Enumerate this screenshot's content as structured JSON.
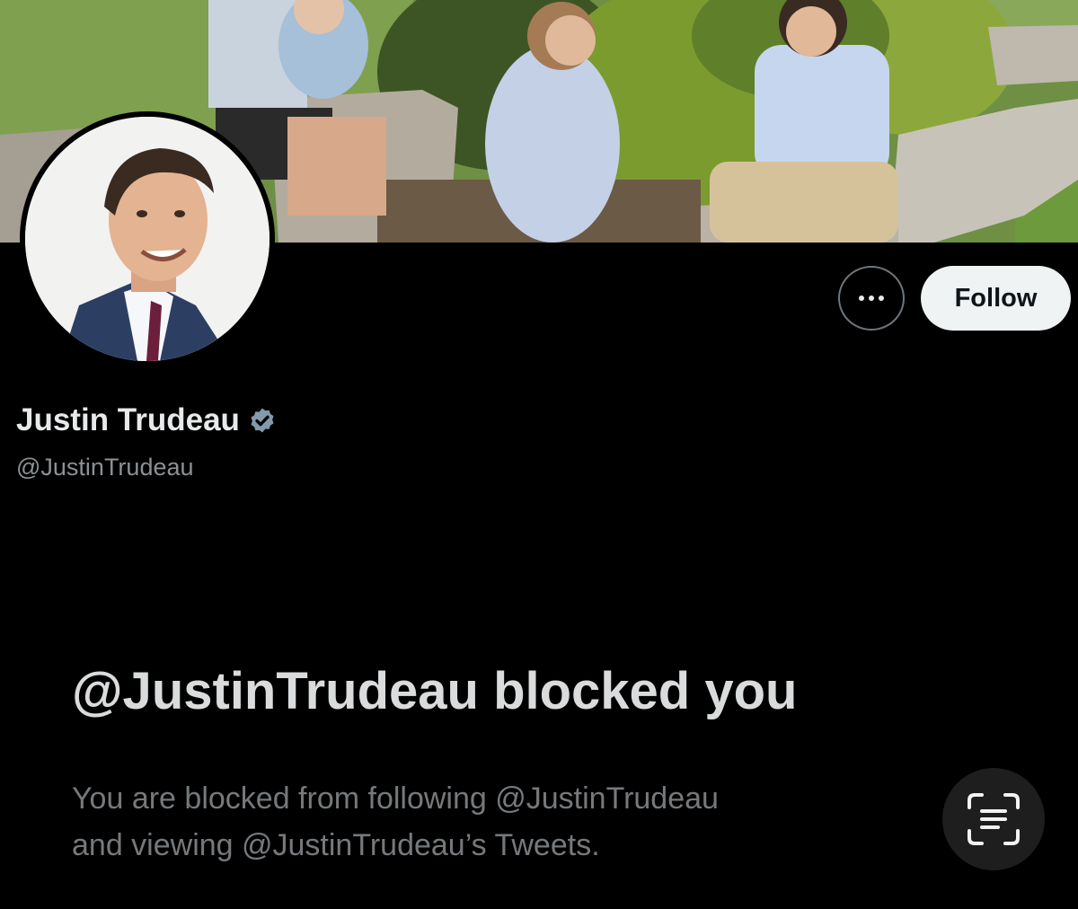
{
  "profile": {
    "display_name": "Justin Trudeau",
    "handle": "@JustinTrudeau",
    "verified": true,
    "verified_color": "#829aab"
  },
  "actions": {
    "follow_label": "Follow"
  },
  "blocked": {
    "title": "@JustinTrudeau blocked you",
    "line1": "You are blocked from following @JustinTrudeau",
    "line2": "and viewing @JustinTrudeau’s Tweets."
  },
  "icons": {
    "more": "more-options-icon",
    "verified": "verified-badge-icon",
    "scan": "live-text-scan-icon"
  },
  "colors": {
    "background": "#000000",
    "follow_bg": "#eff3f4",
    "primary_text": "#e7e9ea",
    "secondary_text": "#8b9196"
  }
}
